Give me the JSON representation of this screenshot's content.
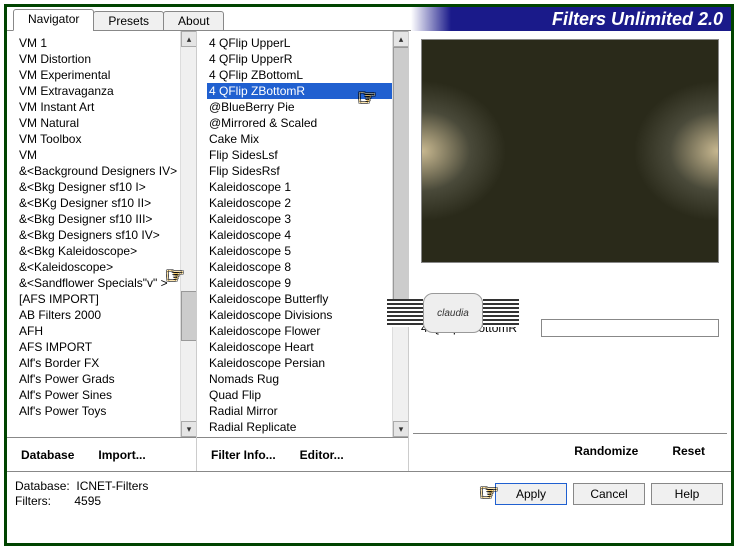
{
  "header": {
    "title": "Filters Unlimited 2.0"
  },
  "tabs": [
    {
      "label": "Navigator",
      "active": true
    },
    {
      "label": "Presets",
      "active": false
    },
    {
      "label": "About",
      "active": false
    }
  ],
  "category_list": [
    "VM 1",
    "VM Distortion",
    "VM Experimental",
    "VM Extravaganza",
    "VM Instant Art",
    "VM Natural",
    "VM Toolbox",
    "VM",
    "&<Background Designers IV>",
    "&<Bkg Designer sf10 I>",
    "&<BKg Designer sf10 II>",
    "&<Bkg Designer sf10 III>",
    "&<Bkg Designers sf10 IV>",
    "&<Bkg Kaleidoscope>",
    "&<Kaleidoscope>",
    "&<Sandflower Specials\"v\" >",
    "[AFS IMPORT]",
    "AB Filters 2000",
    "AFH",
    "AFS IMPORT",
    "Alf's Border FX",
    "Alf's Power Grads",
    "Alf's Power Sines",
    "Alf's Power Toys"
  ],
  "category_highlight_index": 13,
  "filter_list": [
    "4 QFlip UpperL",
    "4 QFlip UpperR",
    "4 QFlip ZBottomL",
    "4 QFlip ZBottomR",
    "@BlueBerry Pie",
    "@Mirrored & Scaled",
    "Cake Mix",
    "Flip SidesLsf",
    "Flip SidesRsf",
    "Kaleidoscope 1",
    "Kaleidoscope 2",
    "Kaleidoscope 3",
    "Kaleidoscope 4",
    "Kaleidoscope 5",
    "Kaleidoscope 8",
    "Kaleidoscope 9",
    "Kaleidoscope Butterfly",
    "Kaleidoscope Divisions",
    "Kaleidoscope Flower",
    "Kaleidoscope Heart",
    "Kaleidoscope Persian",
    "Nomads Rug",
    "Quad Flip",
    "Radial Mirror",
    "Radial Replicate"
  ],
  "filter_selected_index": 3,
  "buttons_col1": {
    "database": "Database",
    "import": "Import..."
  },
  "buttons_col2": {
    "filter_info": "Filter Info...",
    "editor": "Editor..."
  },
  "right": {
    "slider_label": "4 QFlip ZBottomR",
    "randomize": "Randomize",
    "reset": "Reset"
  },
  "footer": {
    "db_label": "Database:",
    "db_value": "ICNET-Filters",
    "filters_label": "Filters:",
    "filters_value": "4595",
    "apply": "Apply",
    "cancel": "Cancel",
    "help": "Help"
  },
  "watermark": "claudia"
}
